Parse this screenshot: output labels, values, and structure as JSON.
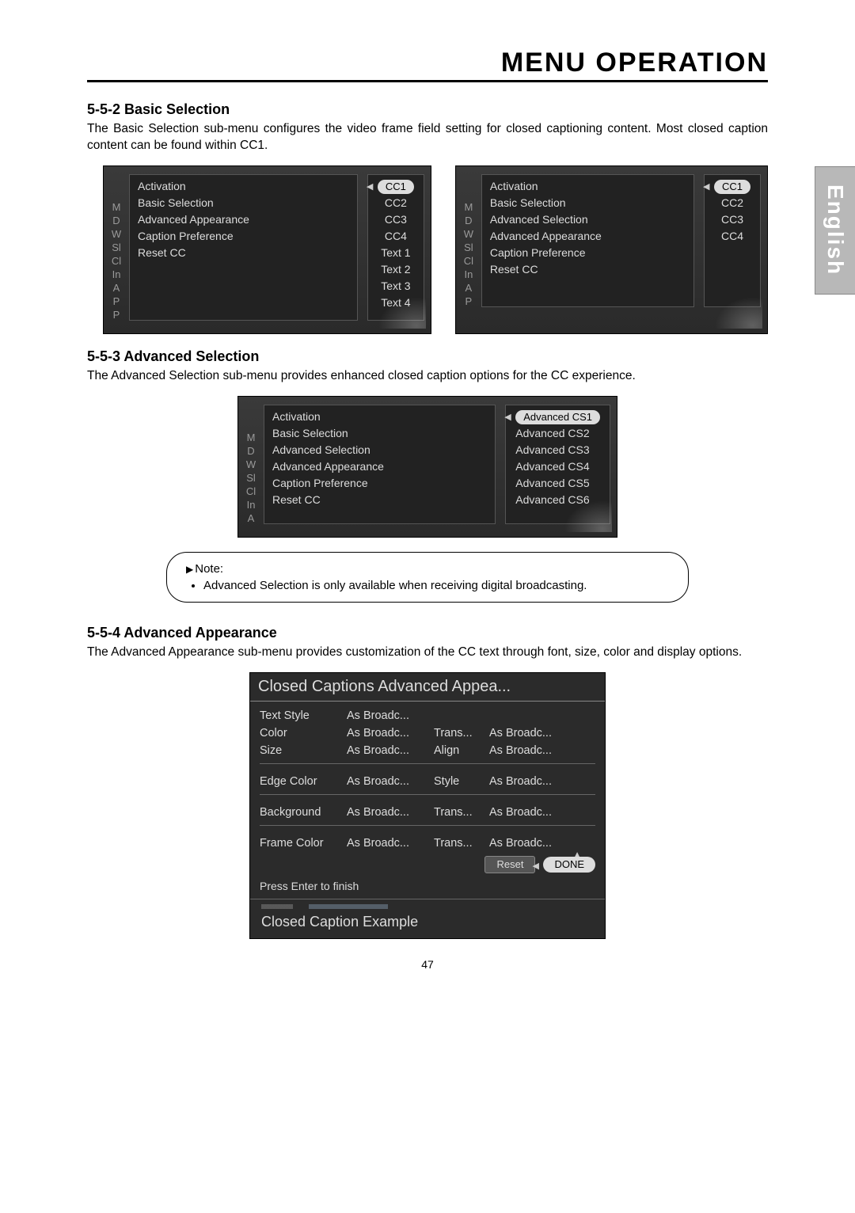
{
  "page": {
    "title": "MENU OPERATION",
    "side_tab": "English",
    "number": "47"
  },
  "sections": {
    "s552": {
      "heading": "5-5-2  Basic Selection",
      "body": "The Basic Selection sub-menu configures the video frame field setting for closed captioning content. Most closed caption content can be found within CC1."
    },
    "s553": {
      "heading": "5-5-3  Advanced Selection",
      "body": "The Advanced Selection sub-menu provides enhanced closed caption options for the CC experience."
    },
    "s554": {
      "heading": "5-5-4  Advanced Appearance",
      "body": "The Advanced Appearance sub-menu provides customization of the CC text through font, size, color and display options."
    }
  },
  "shot_basic_left": {
    "letters": [
      "M",
      "D",
      "W",
      "Sl",
      "Cl",
      "In",
      "A",
      "P",
      "P"
    ],
    "menu": [
      "Activation",
      "Basic Selection",
      "Advanced Appearance",
      "Caption Preference",
      "Reset CC"
    ],
    "selected": "CC1",
    "values": [
      "CC2",
      "CC3",
      "CC4",
      "Text 1",
      "Text 2",
      "Text 3",
      "Text 4"
    ]
  },
  "shot_basic_right": {
    "letters": [
      "M",
      "D",
      "W",
      "Sl",
      "Cl",
      "In",
      "A",
      "P"
    ],
    "menu": [
      "Activation",
      "Basic Selection",
      "Advanced Selection",
      "Advanced Appearance",
      "Caption Preference",
      "Reset CC"
    ],
    "selected": "CC1",
    "values": [
      "CC2",
      "CC3",
      "CC4"
    ]
  },
  "shot_advanced": {
    "letters": [
      "M",
      "D",
      "W",
      "Sl",
      "Cl",
      "In",
      "A"
    ],
    "menu": [
      "Activation",
      "Basic Selection",
      "Advanced Selection",
      "Advanced Appearance",
      "Caption Preference",
      "Reset CC"
    ],
    "selected": "Advanced CS1",
    "values": [
      "Advanced CS2",
      "Advanced CS3",
      "Advanced CS4",
      "Advanced CS5",
      "Advanced CS6"
    ]
  },
  "note": {
    "lead": "Note:",
    "bullet": "Advanced Selection is only available when receiving digital broadcasting."
  },
  "appearance": {
    "title": "Closed Captions Advanced Appea...",
    "rows": [
      {
        "k": "Text Style",
        "v1": "As Broadc...",
        "k2": "",
        "v2": ""
      },
      {
        "k": "Color",
        "v1": "As Broadc...",
        "k2": "Trans...",
        "v2": "As Broadc..."
      },
      {
        "k": "Size",
        "v1": "As Broadc...",
        "k2": "Align",
        "v2": "As Broadc..."
      }
    ],
    "rows2": [
      {
        "k": "Edge Color",
        "v1": "As Broadc...",
        "k2": "Style",
        "v2": "As Broadc..."
      }
    ],
    "rows3": [
      {
        "k": "Background",
        "v1": "As Broadc...",
        "k2": "Trans...",
        "v2": "As Broadc..."
      }
    ],
    "rows4": [
      {
        "k": "Frame Color",
        "v1": "As Broadc...",
        "k2": "Trans...",
        "v2": "As Broadc..."
      }
    ],
    "reset": "Reset",
    "done": "DONE",
    "hint": "Press Enter to finish",
    "example": "Closed Caption Example"
  }
}
